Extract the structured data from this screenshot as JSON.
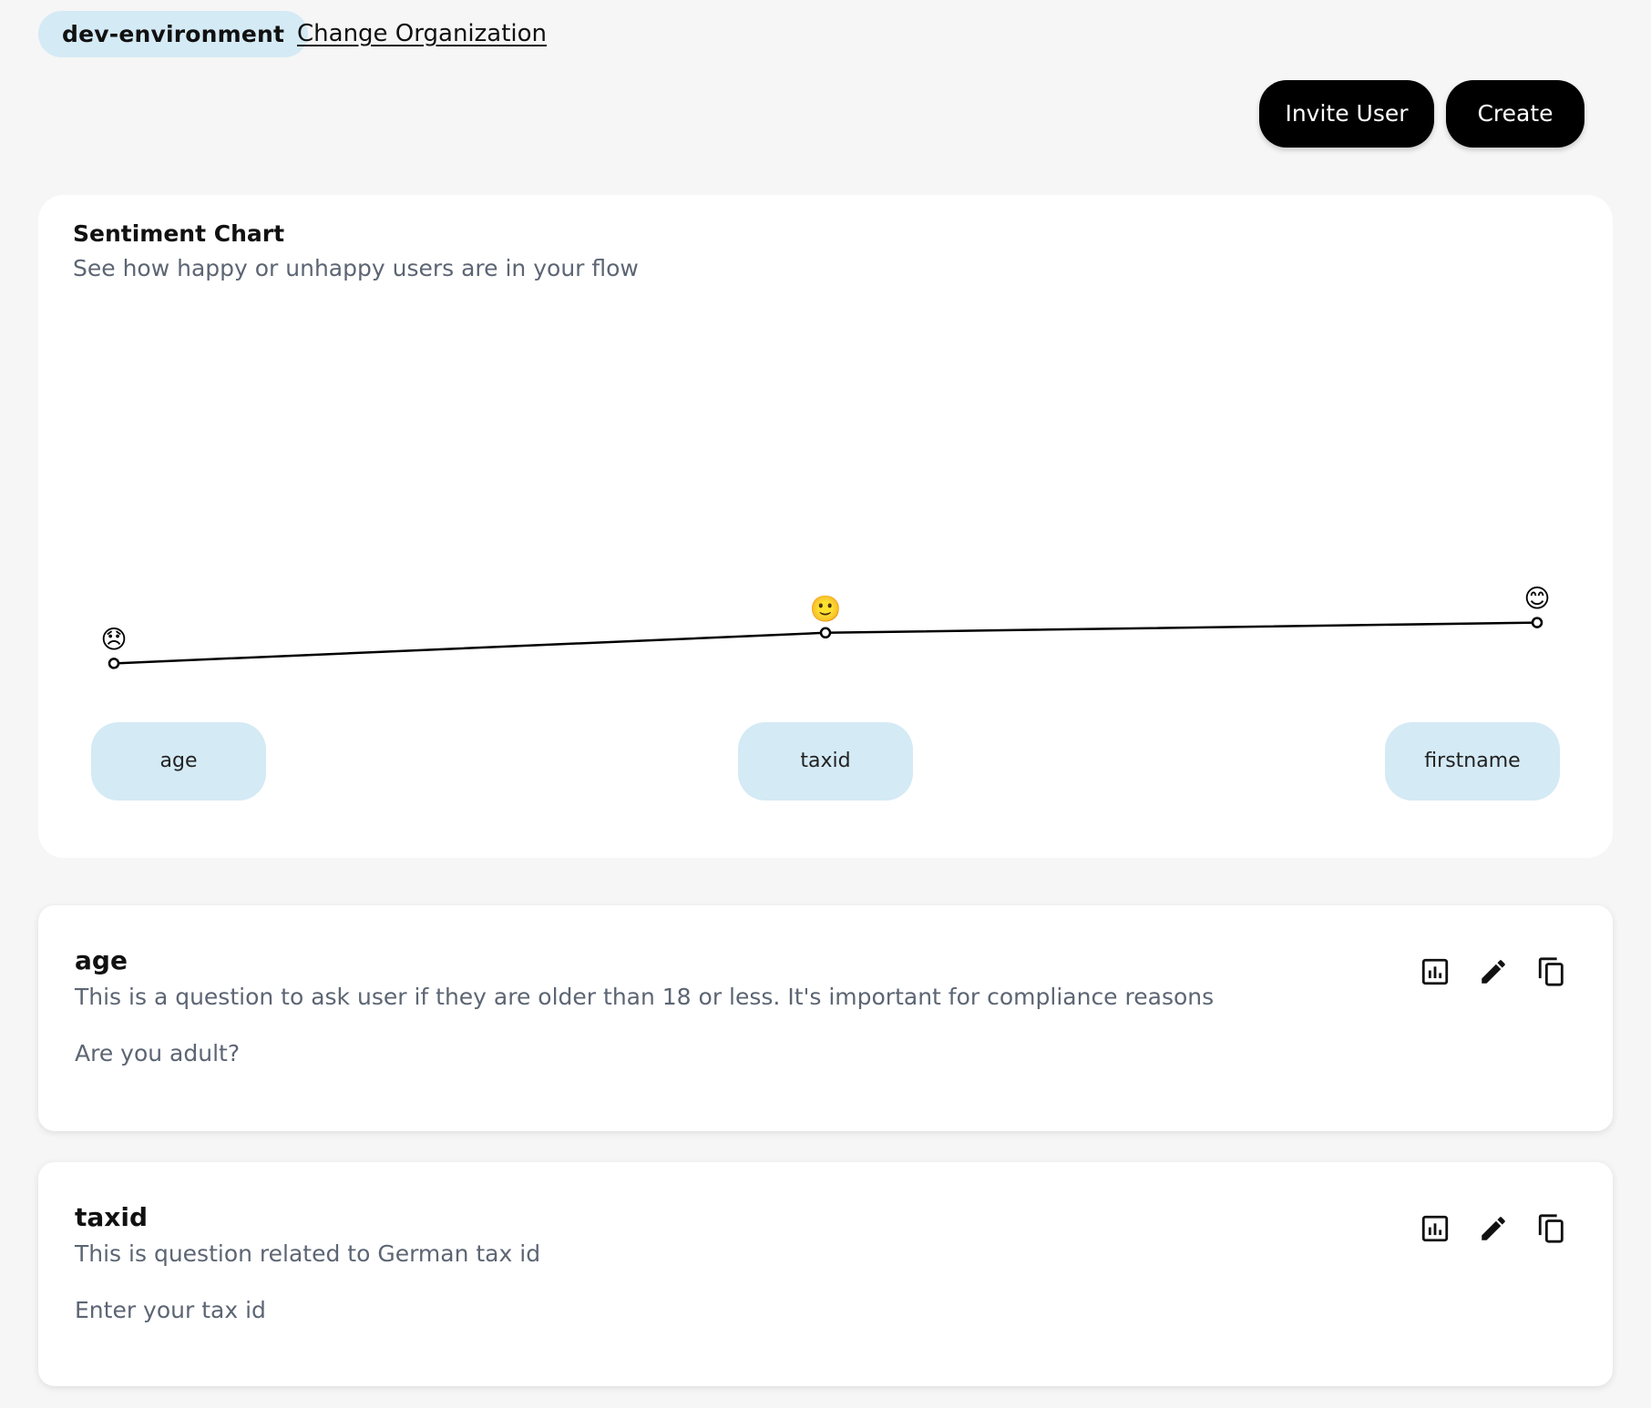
{
  "header": {
    "organization": "dev-environment",
    "change_org_label": "Change Organization",
    "invite_label": "Invite User",
    "create_label": "Create"
  },
  "chart_card": {
    "title": "Sentiment Chart",
    "subtitle": "See how happy or unhappy users are in your flow"
  },
  "chart_data": {
    "type": "line",
    "title": "Sentiment Chart",
    "categories": [
      "age",
      "taxid",
      "firstname"
    ],
    "series": [
      {
        "values": [
          0.26,
          0.32,
          0.34
        ]
      }
    ],
    "markers": [
      "😞",
      "🙂",
      "😊"
    ],
    "ylim": [
      0,
      1
    ],
    "grid": false,
    "line_color": "#000000",
    "pill_color": "#d4eaf5"
  },
  "questions": [
    {
      "title": "age",
      "description": "This is a question to ask user if they are older than 18 or less. It's important for compliance reasons",
      "prompt": "Are you adult?",
      "icons": [
        "bar-chart-icon",
        "pencil-icon",
        "copy-icon"
      ]
    },
    {
      "title": "taxid",
      "description": "This is question related to German tax id",
      "prompt": "Enter your tax id",
      "icons": [
        "bar-chart-icon",
        "pencil-icon",
        "copy-icon"
      ]
    }
  ],
  "colors": {
    "background": "#f6f6f6",
    "card": "#ffffff",
    "accent_pill": "#d4eaf5",
    "button": "#000000",
    "muted_text": "#5c6573"
  }
}
